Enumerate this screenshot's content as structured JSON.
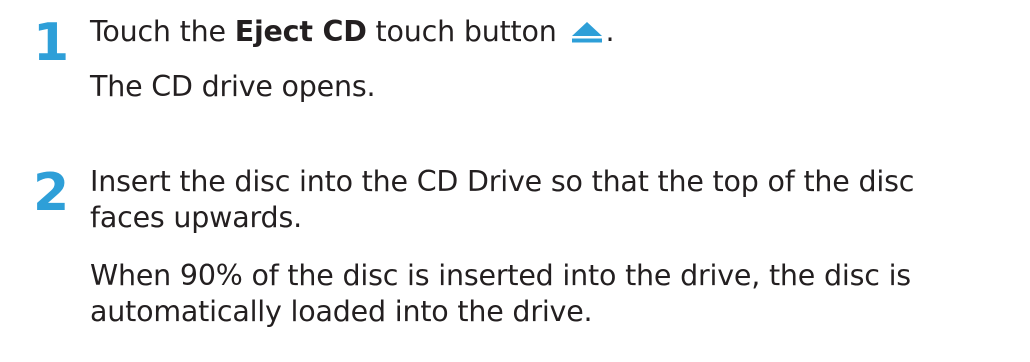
{
  "steps": [
    {
      "number": "1",
      "instruction": {
        "prefix": "Touch the ",
        "bold": "Eject CD",
        "suffix": " touch button",
        "end": "."
      },
      "icon": "eject-icon",
      "result": "The CD drive opens."
    },
    {
      "number": "2",
      "instruction_lines": [
        "Insert the disc into the CD Drive so that the top of the disc",
        "faces upwards."
      ],
      "result_lines": [
        "When 90% of the disc is inserted into the drive, the disc is",
        "automatically loaded into the drive."
      ]
    }
  ],
  "colors": {
    "step_number": "#2e9fd8",
    "icon": "#2e9fd8",
    "text": "#231f20"
  }
}
